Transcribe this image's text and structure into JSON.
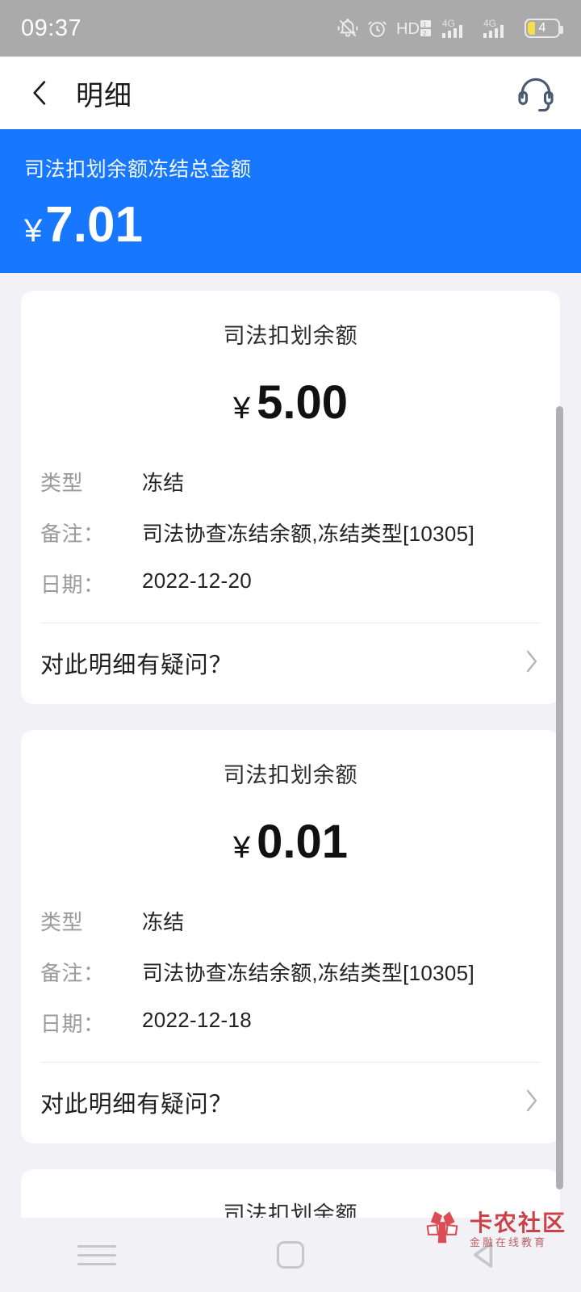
{
  "status_bar": {
    "time": "09:37",
    "battery_level": "4",
    "icons": [
      "bell-muted-icon",
      "alarm-clock-icon",
      "hd-dual-sim-icon",
      "signal-4g-icon",
      "signal-4g-icon",
      "battery-icon"
    ],
    "background_color": "#aaaaaa"
  },
  "header": {
    "back_icon": "chevron-left-icon",
    "title": "明细",
    "support_icon": "headset-icon"
  },
  "summary_banner": {
    "label": "司法扣划余额冻结总金额",
    "currency": "¥",
    "amount": "7.01",
    "background_color": "#1777ff"
  },
  "labels": {
    "type": "类型",
    "remark": "备注：",
    "date": "日期：",
    "question": "对此明细有疑问？",
    "question_chevron": "chevron-right-icon"
  },
  "records": [
    {
      "title": "司法扣划余额",
      "currency": "¥",
      "amount": "5.00",
      "type_value": "冻结",
      "remark_value": "司法协查冻结余额,冻结类型[10305]",
      "date_value": "2022-12-20"
    },
    {
      "title": "司法扣划余额",
      "currency": "¥",
      "amount": "0.01",
      "type_value": "冻结",
      "remark_value": "司法协查冻结余额,冻结类型[10305]",
      "date_value": "2022-12-18"
    },
    {
      "title": "司法扣划余额"
    }
  ],
  "watermark": {
    "main": "卡农社区",
    "sub": "金融在线教育",
    "color": "#c8333a"
  },
  "nav_bar": {
    "recents": "menu-icon",
    "home": "home-square-icon",
    "back": "back-triangle-icon"
  }
}
